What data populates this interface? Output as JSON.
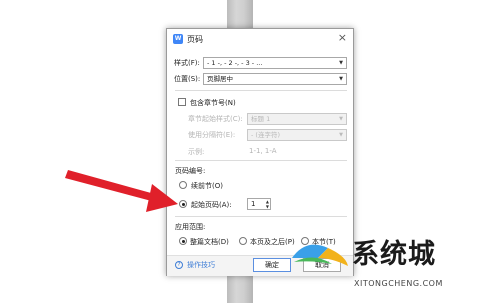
{
  "dialog": {
    "title": "页码",
    "app_icon": "W",
    "close_glyph": "×",
    "style_label": "样式(F):",
    "style_value": "- 1 -, - 2 -, - 3 - ...",
    "position_label": "位置(S):",
    "position_value": "页脚居中",
    "chapter": {
      "checkbox_label": "包含章节号(N)",
      "checked": false,
      "chapter_style_label": "章节起始样式(C):",
      "chapter_style_value": "标题 1",
      "separator_label": "使用分隔符(E):",
      "separator_value": "- (连字符)",
      "example_label": "示例:",
      "example_value": "1-1, 1-A"
    },
    "numbering": {
      "section_label": "页码编号:",
      "continue_label": "续前节(O)",
      "start_label": "起始页码(A):",
      "start_value": "1",
      "selected": "start"
    },
    "apply": {
      "section_label": "应用范围:",
      "options": [
        "整篇文档(D)",
        "本页及之后(P)",
        "本节(T)"
      ],
      "selected": 0
    },
    "footer": {
      "tips_label": "操作技巧",
      "ok_label": "确定",
      "cancel_label": "取消"
    }
  },
  "watermark": {
    "brand": "系统城",
    "url": "XITONGCHENG.COM"
  },
  "colors": {
    "arrow": "#e0202a",
    "link": "#3f7ed6",
    "app_icon": "#3f86f7"
  }
}
